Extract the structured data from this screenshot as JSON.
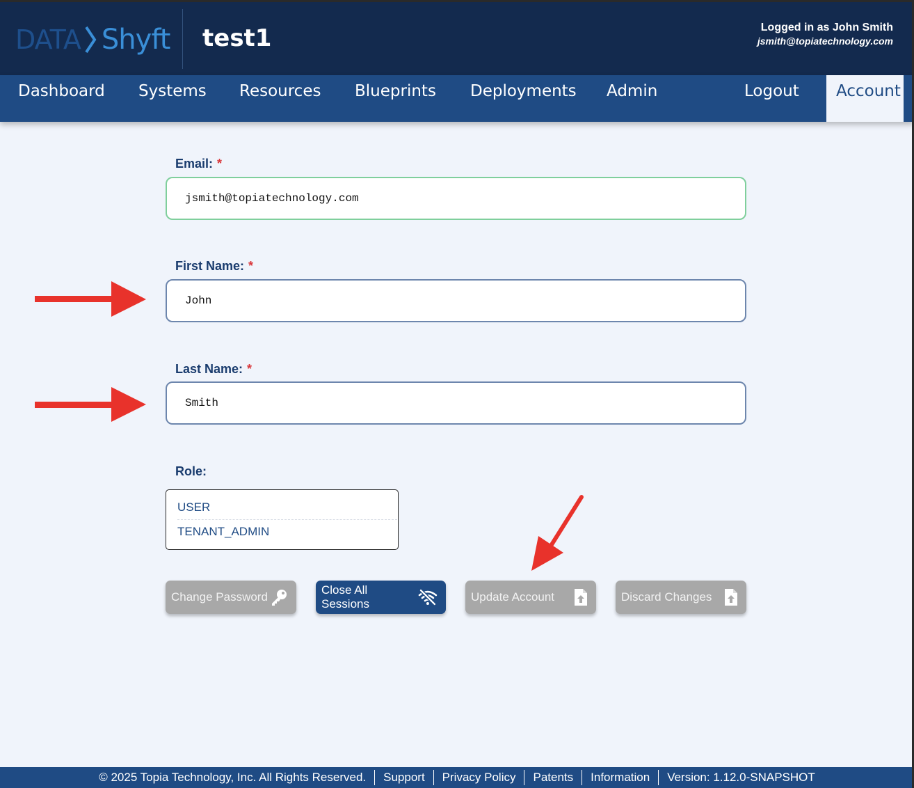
{
  "header": {
    "logo_data": "DATA",
    "logo_shyft": "Shyft",
    "tenant": "test1",
    "logged_in_as": "Logged in as John Smith",
    "user_email": "jsmith@topiatechnology.com"
  },
  "nav": {
    "items": [
      "Dashboard",
      "Systems",
      "Resources",
      "Blueprints",
      "Deployments",
      "Admin"
    ],
    "logout": "Logout",
    "account": "Account"
  },
  "form": {
    "email": {
      "label": "Email:",
      "required_mark": "*",
      "value": "jsmith@topiatechnology.com"
    },
    "first_name": {
      "label": "First Name:",
      "required_mark": "*",
      "value": "John"
    },
    "last_name": {
      "label": "Last Name:",
      "required_mark": "*",
      "value": "Smith"
    },
    "role": {
      "label": "Role:",
      "options": [
        "USER",
        "TENANT_ADMIN"
      ]
    }
  },
  "buttons": {
    "change_password": "Change Password",
    "close_sessions": "Close All Sessions",
    "update_account": "Update Account",
    "discard_changes": "Discard Changes"
  },
  "footer": {
    "copyright": "© 2025 Topia Technology, Inc. All Rights Reserved.",
    "support": "Support",
    "privacy": "Privacy Policy",
    "patents": "Patents",
    "information": "Information",
    "version": "Version: 1.12.0-SNAPSHOT"
  },
  "colors": {
    "header_bg": "#132a4e",
    "nav_bg": "#1f4b84",
    "page_bg": "#f0f4fb",
    "annotation_arrow": "#e8322b",
    "required": "#d9373b"
  }
}
